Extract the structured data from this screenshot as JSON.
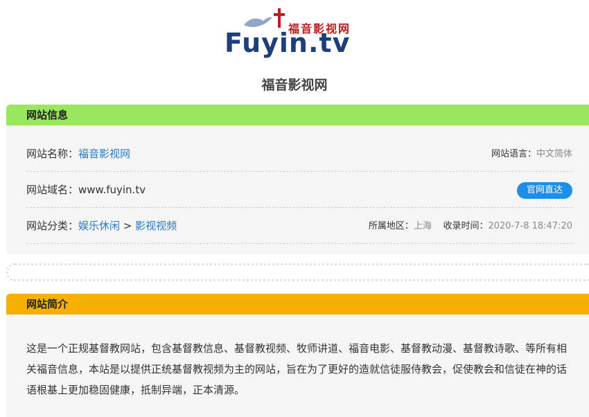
{
  "logo": {
    "brand_cn": "福音影视网",
    "brand_en": "Fuyin.tv"
  },
  "site_title": "福音影视网",
  "info_panel": {
    "heading": "网站信息",
    "name_label": "网站名称：",
    "name_value": "福音影视网",
    "language_label": "网站语言：",
    "language_value": "中文简体",
    "domain_label": "网站域名：",
    "domain_value": "www.fuyin.tv",
    "visit_button": "官网直达",
    "category_label": "网站分类：",
    "category_main": "娱乐休闲",
    "category_sep": ">",
    "category_sub": "影视视频",
    "region_label": "所属地区：",
    "region_value": "上海",
    "time_label": "收录时间：",
    "time_value": "2020-7-8 18:47:20"
  },
  "intro_panel": {
    "heading": "网站简介",
    "text": "这是一个正规基督教网站，包含基督教信息、基督教视频、牧师讲道、福音电影、基督教动漫、基督教诗歌、等所有相关福音信息，本站是以提供正统基督教视频为主的网站，旨在为了更好的造就信徒服侍教会，促使教会和信徒在神的话语根基上更加稳固健康，抵制异端，正本清源。"
  },
  "colors": {
    "info_header": "#99e65f",
    "intro_header": "#f6b100",
    "link": "#2a78c6",
    "button": "#1e8fe8",
    "logo_blue": "#1f3f7a",
    "logo_red": "#b81c1c"
  }
}
